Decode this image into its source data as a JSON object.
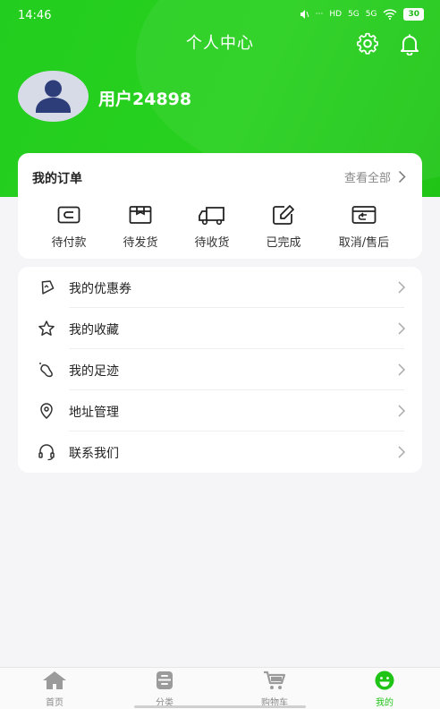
{
  "status_bar": {
    "time": "14:46",
    "signal_texts": [
      "···",
      "HD",
      "5G",
      "5G"
    ],
    "battery": "30"
  },
  "header": {
    "title": "个人中心",
    "settings_icon": "gear-icon",
    "notify_icon": "bell-icon"
  },
  "profile": {
    "username": "用户24898",
    "avatar_icon": "user-avatar-icon"
  },
  "orders": {
    "title": "我的订单",
    "view_all_label": "查看全部",
    "items": [
      {
        "label": "待付款",
        "icon": "wallet-icon"
      },
      {
        "label": "待发货",
        "icon": "package-icon"
      },
      {
        "label": "待收货",
        "icon": "truck-icon"
      },
      {
        "label": "已完成",
        "icon": "edit-icon"
      },
      {
        "label": "取消/售后",
        "icon": "return-icon"
      }
    ]
  },
  "menu": {
    "items": [
      {
        "label": "我的优惠券",
        "icon": "coupon-icon"
      },
      {
        "label": "我的收藏",
        "icon": "star-icon"
      },
      {
        "label": "我的足迹",
        "icon": "footprint-icon"
      },
      {
        "label": "地址管理",
        "icon": "location-icon"
      },
      {
        "label": "联系我们",
        "icon": "headset-icon"
      }
    ]
  },
  "tabbar": {
    "tabs": [
      {
        "label": "首页",
        "icon": "home-icon",
        "active": false
      },
      {
        "label": "分类",
        "icon": "category-icon",
        "active": false
      },
      {
        "label": "购物车",
        "icon": "cart-icon",
        "active": false
      },
      {
        "label": "我的",
        "icon": "smiley-icon",
        "active": true
      }
    ]
  },
  "colors": {
    "brand_green": "#23cd1f",
    "active_tab": "#1fc417",
    "background": "#f5f5f7"
  }
}
